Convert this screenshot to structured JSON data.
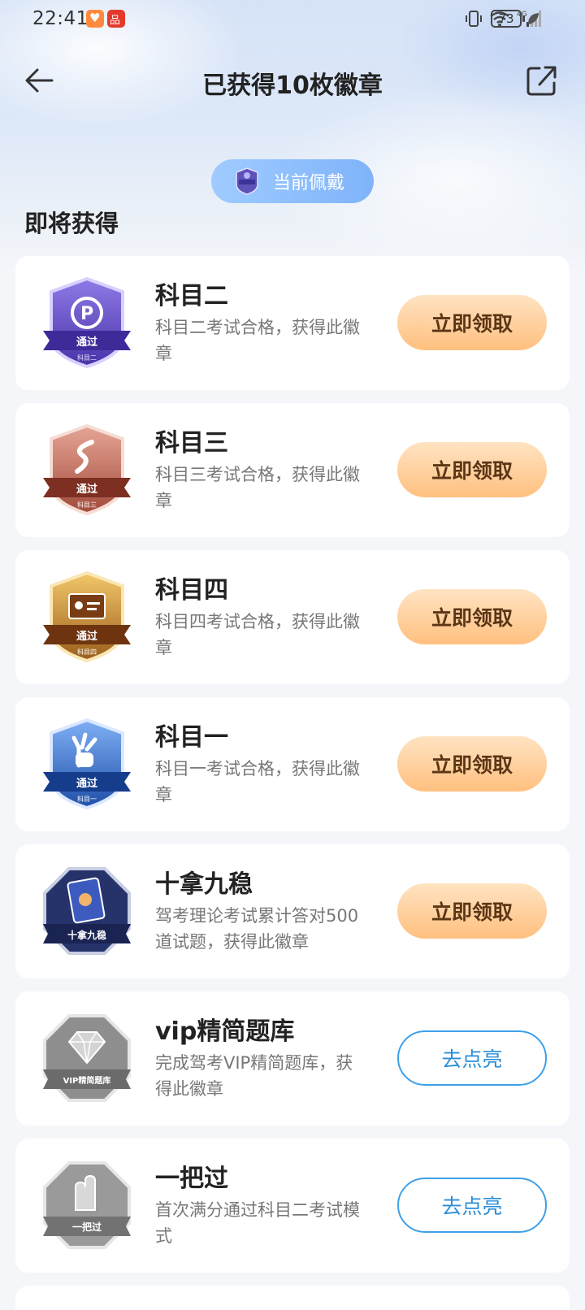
{
  "status_bar": {
    "time": "22:41",
    "battery": "73",
    "network": "4G"
  },
  "nav": {
    "title": "已获得10枚徽章"
  },
  "wearing": {
    "label": "当前佩戴"
  },
  "section": {
    "title": "即将获得"
  },
  "colors": {
    "claim_bg": "#ffc07f",
    "lightup_border": "#3da0ea",
    "pill": "#8fbdfc"
  },
  "badges": [
    {
      "title": "科目二",
      "desc": "科目二考试合格，获得此徽章",
      "action": "立即领取",
      "badge_icon": "subject-two-badge-icon",
      "badge_text": "通过",
      "badge_sub": "科目二"
    },
    {
      "title": "科目三",
      "desc": "科目三考试合格，获得此徽章",
      "action": "立即领取",
      "badge_icon": "subject-three-badge-icon",
      "badge_text": "通过",
      "badge_sub": "科目三"
    },
    {
      "title": "科目四",
      "desc": "科目四考试合格，获得此徽章",
      "action": "立即领取",
      "badge_icon": "subject-four-badge-icon",
      "badge_text": "通过",
      "badge_sub": "科目四"
    },
    {
      "title": "科目一",
      "desc": "科目一考试合格，获得此徽章",
      "action": "立即领取",
      "badge_icon": "subject-one-badge-icon",
      "badge_text": "通过",
      "badge_sub": "科目一"
    },
    {
      "title": "十拿九稳",
      "desc": "驾考理论考试累计答对500道试题，获得此徽章",
      "action": "立即领取",
      "badge_icon": "ten-nine-steady-badge-icon",
      "badge_text": "十拿九稳"
    },
    {
      "title": "vip精简题库",
      "desc": "完成驾考VIP精简题库，获得此徽章",
      "action": "去点亮",
      "badge_icon": "vip-question-bank-badge-icon",
      "badge_text": "VIP精简题库"
    },
    {
      "title": "一把过",
      "desc": "首次满分通过科目二考试模式",
      "action": "去点亮",
      "badge_icon": "one-pass-badge-icon",
      "badge_text": "一把过"
    }
  ]
}
